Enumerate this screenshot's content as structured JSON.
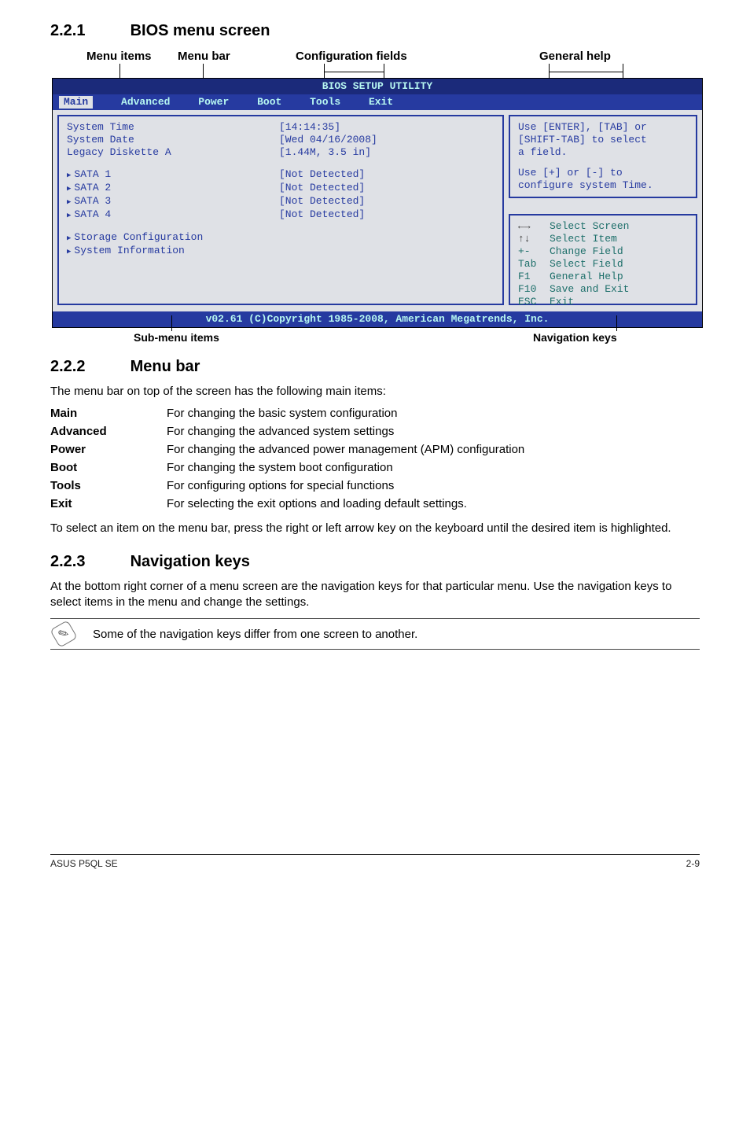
{
  "sections": {
    "s1": {
      "num": "2.2.1",
      "title": "BIOS menu screen"
    },
    "s2": {
      "num": "2.2.2",
      "title": "Menu bar"
    },
    "s3": {
      "num": "2.2.3",
      "title": "Navigation keys"
    }
  },
  "diagram": {
    "top_labels": {
      "menu_items": "Menu items",
      "menu_bar": "Menu bar",
      "config_fields": "Configuration fields",
      "general_help": "General help"
    },
    "bios_title": "BIOS SETUP UTILITY",
    "menubar": {
      "main": "Main",
      "advanced": "Advanced",
      "power": "Power",
      "boot": "Boot",
      "tools": "Tools",
      "exit": "Exit"
    },
    "left_rows": {
      "r0l": "System Time",
      "r0v": "[14:14:35]",
      "r1l": "System Date",
      "r1v": "[Wed 04/16/2008]",
      "r2l": "Legacy Diskette A",
      "r2v": "[1.44M, 3.5 in]",
      "r3l": "SATA 1",
      "r3v": "[Not Detected]",
      "r4l": "SATA 2",
      "r4v": "[Not Detected]",
      "r5l": "SATA 3",
      "r5v": "[Not Detected]",
      "r6l": "SATA 4",
      "r6v": "[Not Detected]",
      "r7l": "Storage Configuration",
      "r8l": "System Information"
    },
    "help1": {
      "l0": "Use [ENTER], [TAB] or",
      "l1": "[SHIFT-TAB] to select",
      "l2": "a field.",
      "l3": "Use [+] or [-] to",
      "l4": "configure system Time."
    },
    "help2": {
      "h0k": "←→",
      "h0t": "Select Screen",
      "h1k": "↑↓",
      "h1t": "Select Item",
      "h2k": "+-",
      "h2t": "Change Field",
      "h3k": "Tab",
      "h3t": "Select Field",
      "h4k": "F1",
      "h4t": "General Help",
      "h5k": "F10",
      "h5t": "Save and Exit",
      "h6k": "ESC",
      "h6t": "Exit"
    },
    "bios_foot": "v02.61 (C)Copyright 1985-2008, American Megatrends, Inc.",
    "bottom_labels": {
      "sub": "Sub-menu items",
      "nav": "Navigation keys"
    }
  },
  "menubar_intro": "The menu bar on top of the screen has the following main items:",
  "menubar_defs": {
    "k0": "Main",
    "v0": "For changing the basic system configuration",
    "k1": "Advanced",
    "v1": "For changing the advanced system settings",
    "k2": "Power",
    "v2": "For changing the advanced power management (APM) configuration",
    "k3": "Boot",
    "v3": "For changing the system boot configuration",
    "k4": "Tools",
    "v4": "For configuring options for special functions",
    "k5": "Exit",
    "v5": "For selecting the exit options and loading default settings."
  },
  "menubar_note": "To select an item on the menu bar, press the right or left arrow key on the keyboard until the desired item is highlighted.",
  "navkeys_para": "At the bottom right corner of a menu screen are the navigation keys for that particular menu. Use the navigation keys to select items in the menu and change the settings.",
  "note_text": "Some of the navigation keys differ from one screen to another.",
  "footer": {
    "left": "ASUS P5QL SE",
    "right": "2-9"
  }
}
